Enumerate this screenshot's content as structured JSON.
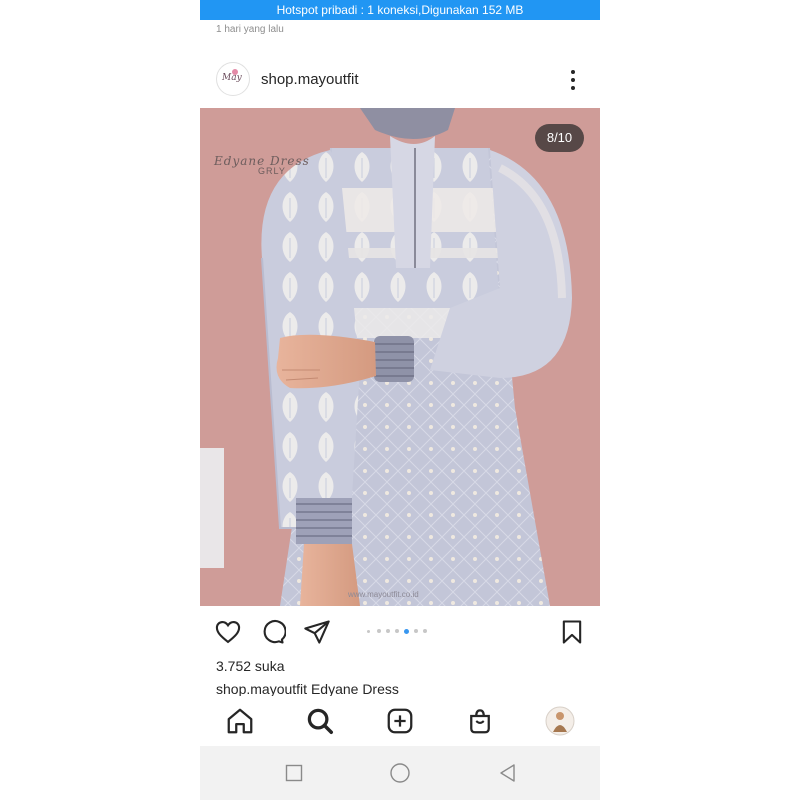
{
  "status": {
    "hotspot_text": "Hotspot pribadi : 1 koneksi,Digunakan 152 MB"
  },
  "post": {
    "time_ago": "1 hari yang lalu",
    "username": "shop.mayoutfit",
    "avatar_text": "May",
    "counter": "8/10",
    "carousel": {
      "total_dots": 6,
      "active_index": 4
    },
    "photo_watermark_1": "Edyane Dress",
    "photo_watermark_2": "GRLY",
    "photo_url": "www.mayoutfit.co.id",
    "likes": "3.752 suka",
    "caption_user": "shop.mayoutfit",
    "caption_text": "Edyane Dress"
  },
  "icons": {
    "like": "heart-icon",
    "comment": "comment-icon",
    "share": "send-icon",
    "save": "bookmark-icon",
    "more": "more-options-icon",
    "nav": [
      "home-icon",
      "search-icon",
      "add-post-icon",
      "shop-icon",
      "profile-avatar"
    ],
    "system": [
      "recents-icon",
      "home-circle-icon",
      "back-icon"
    ]
  },
  "colors": {
    "hotspot_bar": "#2196f3",
    "photo_bg": "#cf9c98",
    "dress": "#c2c6d8",
    "dot_active": "#3897f0"
  }
}
